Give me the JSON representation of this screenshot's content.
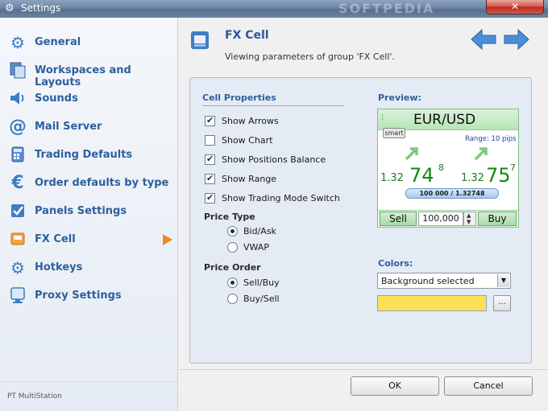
{
  "window": {
    "title": "Settings",
    "watermark": "SOFTPEDIA"
  },
  "sidebar": {
    "items": [
      {
        "label": "General",
        "icon": "gear-icon"
      },
      {
        "label": "Workspaces and Layouts",
        "icon": "layouts-icon"
      },
      {
        "label": "Sounds",
        "icon": "speaker-icon"
      },
      {
        "label": "Mail Server",
        "icon": "at-icon"
      },
      {
        "label": "Trading Defaults",
        "icon": "calculator-icon"
      },
      {
        "label": "Order defaults by type",
        "icon": "euro-icon"
      },
      {
        "label": "Panels Settings",
        "icon": "checkbox-icon"
      },
      {
        "label": "FX Cell",
        "icon": "fx-cell-icon",
        "active": true
      },
      {
        "label": "Hotkeys",
        "icon": "gear-icon"
      },
      {
        "label": "Proxy Settings",
        "icon": "proxy-icon"
      }
    ],
    "footer": "PT MultiStation"
  },
  "main": {
    "title": "FX Cell",
    "subtitle": "Viewing parameters of group 'FX Cell'.",
    "cell_properties": {
      "heading": "Cell Properties",
      "options": [
        {
          "label": "Show Arrows",
          "checked": true
        },
        {
          "label": "Show Chart",
          "checked": false
        },
        {
          "label": "Show Positions Balance",
          "checked": true
        },
        {
          "label": "Show Range",
          "checked": true
        },
        {
          "label": "Show Trading Mode Switch",
          "checked": true
        }
      ]
    },
    "price_type": {
      "heading": "Price Type",
      "options": [
        {
          "label": "Bid/Ask",
          "selected": true
        },
        {
          "label": "VWAP",
          "selected": false
        }
      ]
    },
    "price_order": {
      "heading": "Price Order",
      "options": [
        {
          "label": "Sell/Buy",
          "selected": true
        },
        {
          "label": "Buy/Sell",
          "selected": false
        }
      ]
    },
    "preview": {
      "heading": "Preview:",
      "pair": "EUR/USD",
      "smart_label": "smart",
      "range": "Range: 10 pips",
      "sell_price": {
        "prefix": "1.32",
        "big": "74",
        "sup": "8"
      },
      "buy_price": {
        "prefix": "1.32",
        "big": "75",
        "sup": "7"
      },
      "balance": "100 000 / 1.32748",
      "sell_label": "Sell",
      "buy_label": "Buy",
      "quantity": "100,000"
    },
    "colors": {
      "heading": "Colors:",
      "selected": "Background selected",
      "swatch": "#fce05a",
      "more_label": "..."
    },
    "buttons": {
      "ok": "OK",
      "cancel": "Cancel"
    }
  },
  "theme": {
    "accent": "#2d5f9e",
    "active_arrow": "#f08a24",
    "fx_green": "#0f8a0f"
  }
}
